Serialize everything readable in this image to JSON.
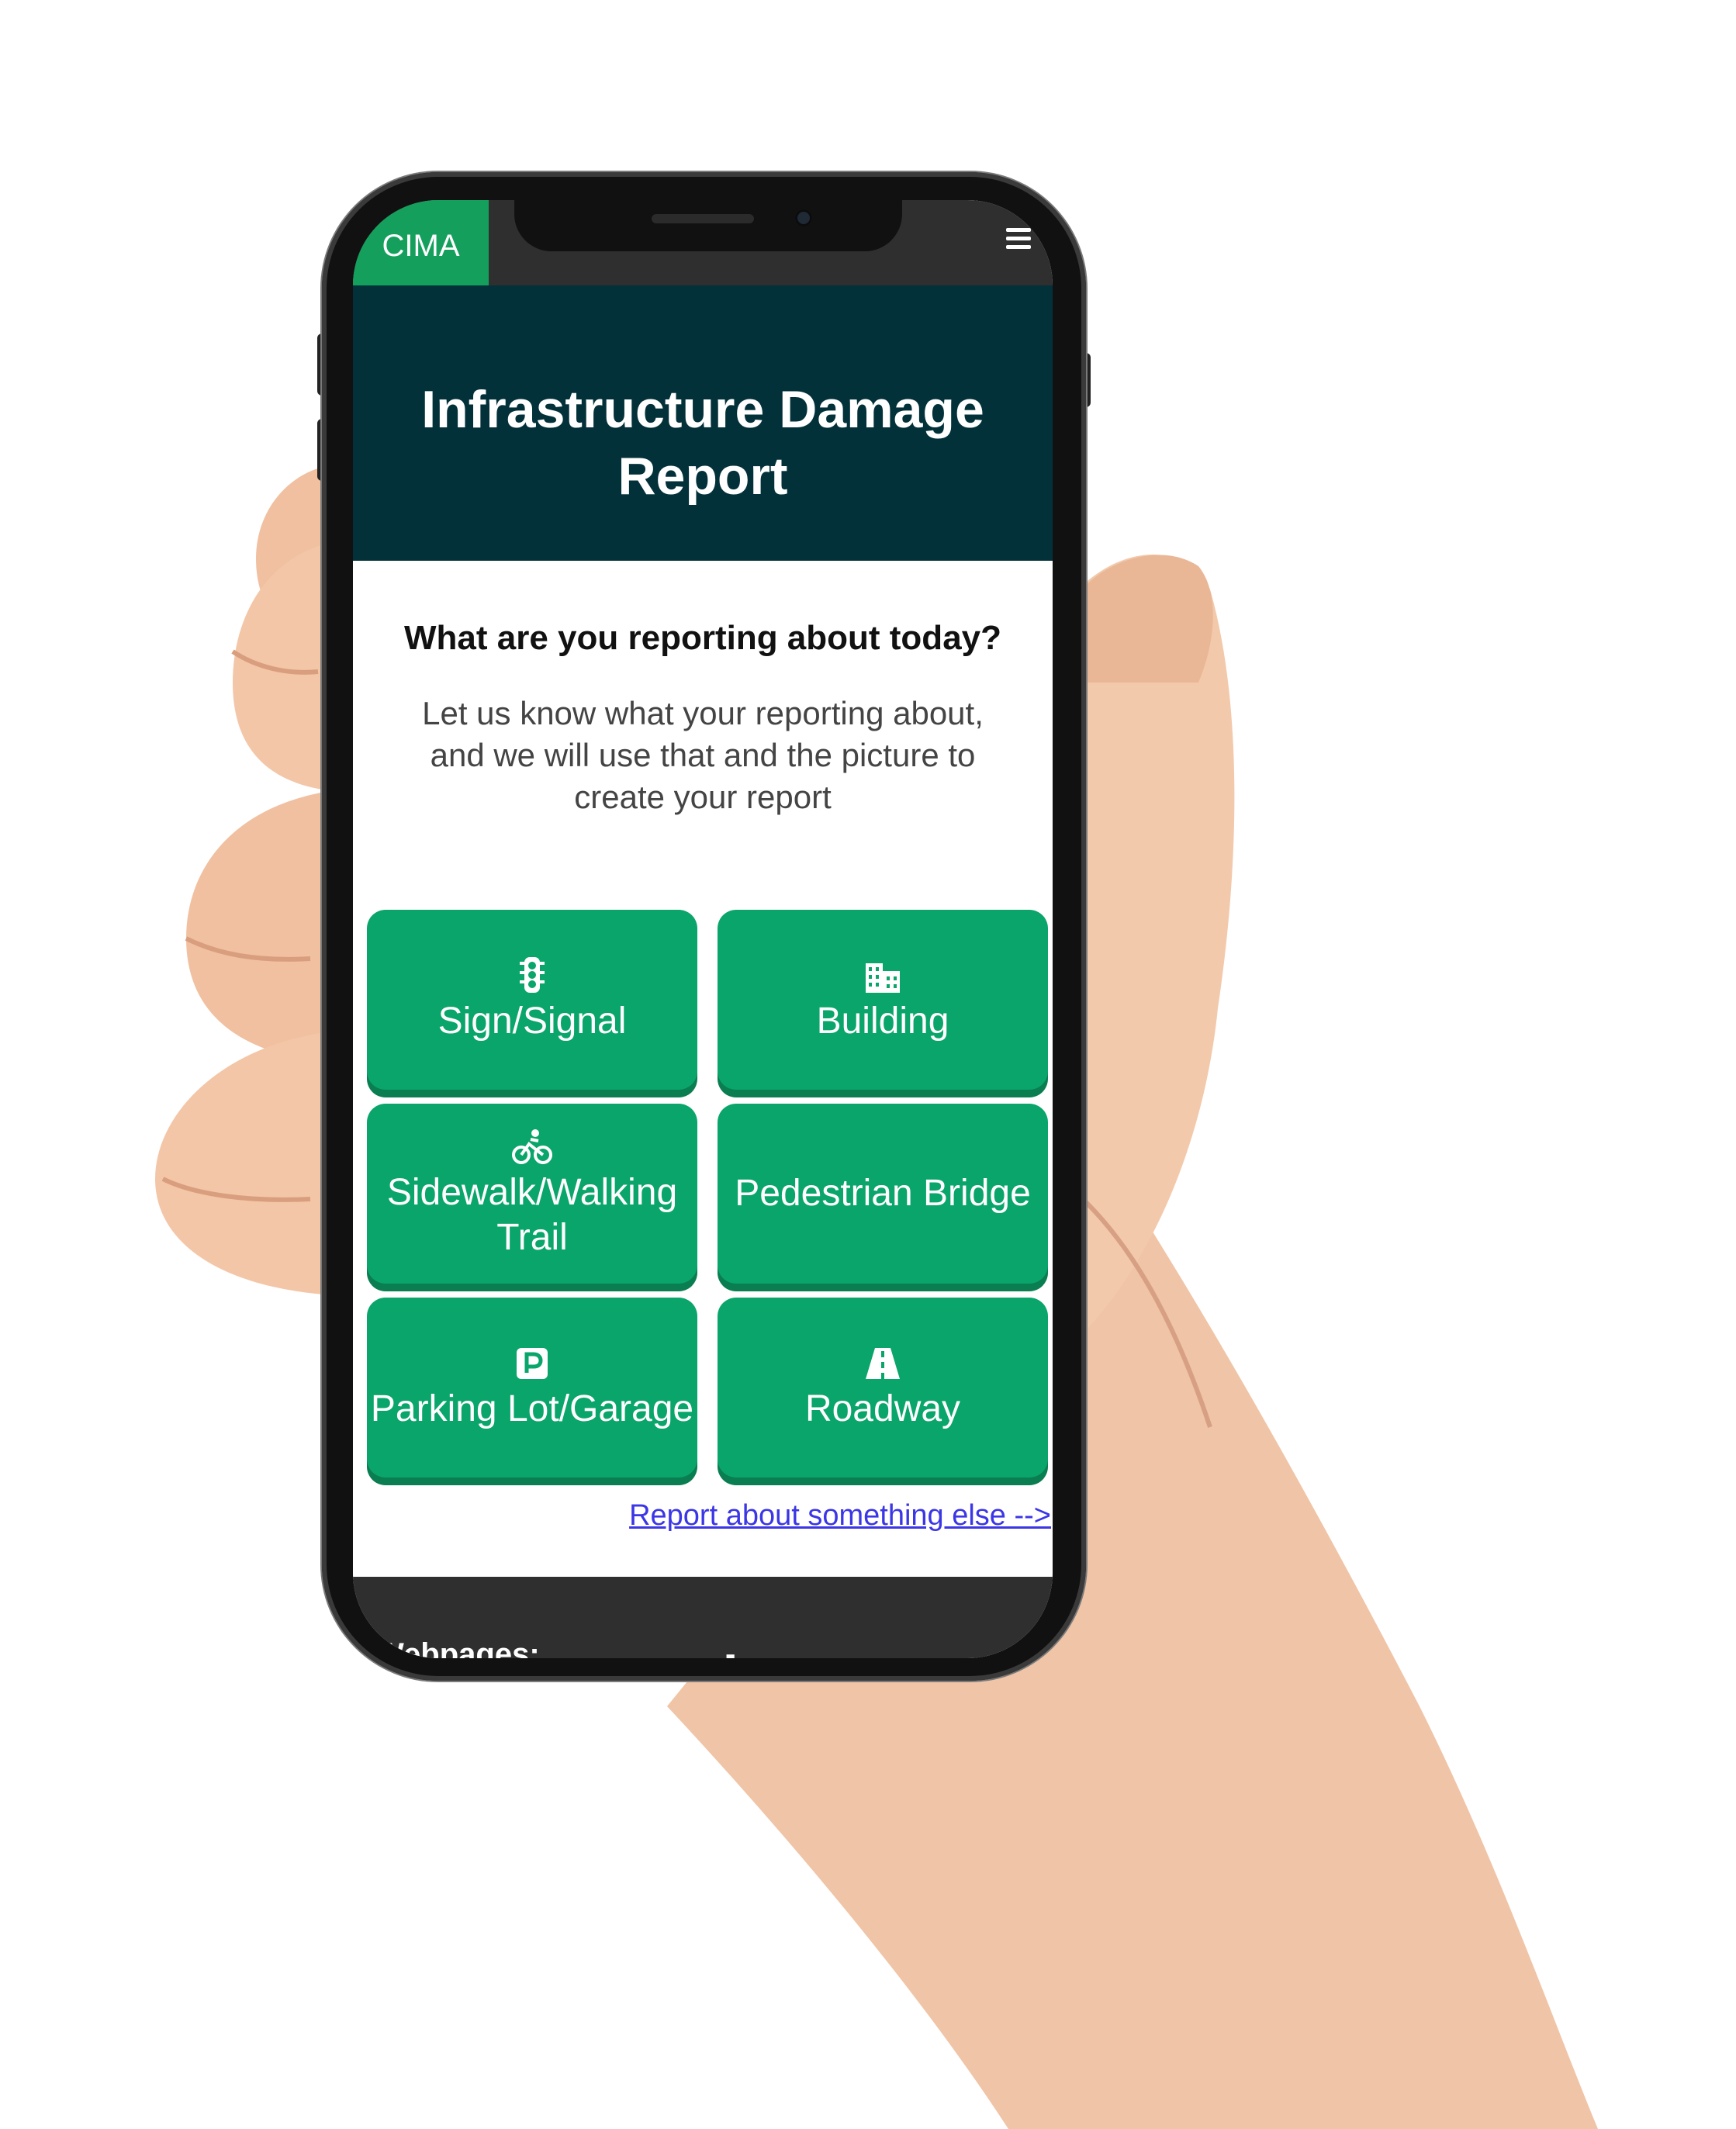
{
  "app": {
    "brand": "CIMA",
    "menu_icon": "hamburger-menu-icon",
    "title": "Infrastructure Damage Report"
  },
  "content": {
    "question": "What are you reporting about today?",
    "intro": "Let us know what your reporting about, and we will use that and the picture to create your report"
  },
  "categories": [
    {
      "label": "Sign/Signal",
      "icon": "traffic-light-icon"
    },
    {
      "label": "Building",
      "icon": "building-icon"
    },
    {
      "label": "Sidewalk/Walking Trail",
      "icon": "bicycle-icon"
    },
    {
      "label": "Pedestrian Bridge",
      "icon": ""
    },
    {
      "label": "Parking Lot/Garage",
      "icon": "parking-icon"
    },
    {
      "label": "Roadway",
      "icon": "road-icon"
    }
  ],
  "other_link": "Report about something else -->",
  "footer": {
    "title": "Webpages:",
    "dash": "-"
  },
  "colors": {
    "brand_green": "#14a05c",
    "tile_green": "#0aa56a",
    "header_teal": "#03313a",
    "bar_dark": "#2f2f2f",
    "link_blue": "#3b36e6"
  }
}
